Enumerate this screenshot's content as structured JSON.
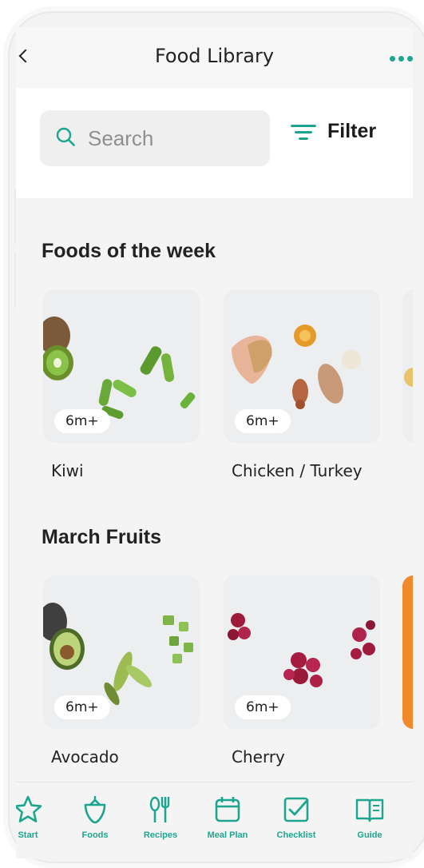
{
  "app": {
    "title": "Food Library",
    "accent_color": "#1da58f"
  },
  "search": {
    "placeholder": "Search"
  },
  "filter": {
    "label": "Filter"
  },
  "sections": [
    {
      "title": "Foods of the week",
      "items": [
        {
          "name": "Kiwi",
          "age": "6m+"
        },
        {
          "name": "Chicken / Turkey",
          "age": "6m+"
        }
      ]
    },
    {
      "title": "March Fruits",
      "items": [
        {
          "name": "Avocado",
          "age": "6m+"
        },
        {
          "name": "Cherry",
          "age": "6m+"
        }
      ]
    }
  ],
  "tabs": [
    {
      "label": "Start",
      "icon": "star-icon"
    },
    {
      "label": "Foods",
      "icon": "strawberry-icon"
    },
    {
      "label": "Recipes",
      "icon": "utensils-icon"
    },
    {
      "label": "Meal Plan",
      "icon": "calendar-icon"
    },
    {
      "label": "Checklist",
      "icon": "checklist-icon"
    },
    {
      "label": "Guide",
      "icon": "book-icon"
    }
  ]
}
